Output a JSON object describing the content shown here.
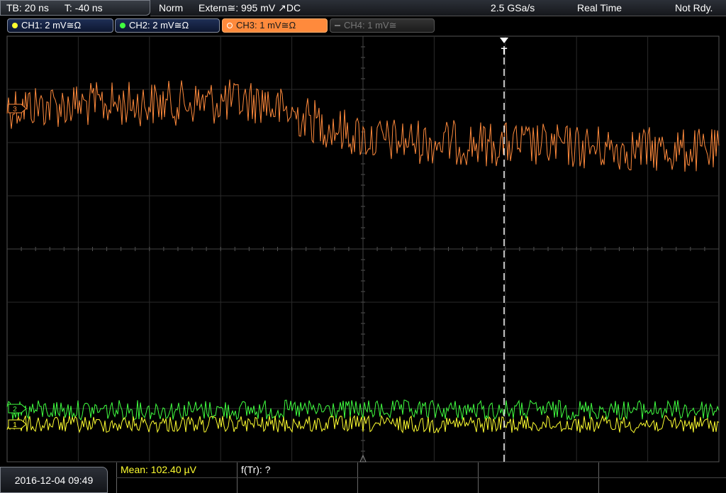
{
  "topbar": {
    "timebase": "TB: 20 ns",
    "trigger_time": "T: -40 ns",
    "trigger_mode": "Norm",
    "trigger_source": "Extern≅: 995 mV ↗DC",
    "sample_rate": "2.5 GSa/s",
    "acq_mode": "Real Time",
    "status": "Not Rdy."
  },
  "channels": [
    {
      "label": "CH1: 2 mV≅Ω",
      "color": "#ffff30",
      "state": "on"
    },
    {
      "label": "CH2: 2 mV≅Ω",
      "color": "#40ff40",
      "state": "on"
    },
    {
      "label": "CH3: 1 mV≅Ω",
      "color": "#ff8a3c",
      "state": "active"
    },
    {
      "label": "CH4: 1 mV≅",
      "color": "#777777",
      "state": "off"
    }
  ],
  "markers": {
    "ch1": "1",
    "ch2": "2",
    "ch3": "3",
    "trigger": "T"
  },
  "footer": {
    "datetime": "2016-12-04 09:49",
    "mean": "Mean: 102.40 µV",
    "ftr": "f(Tr): ?"
  },
  "colors": {
    "ch1": "#ffff30",
    "ch2": "#40ff40",
    "ch3": "#ff8a3c",
    "grid": "#2a2a2a"
  }
}
